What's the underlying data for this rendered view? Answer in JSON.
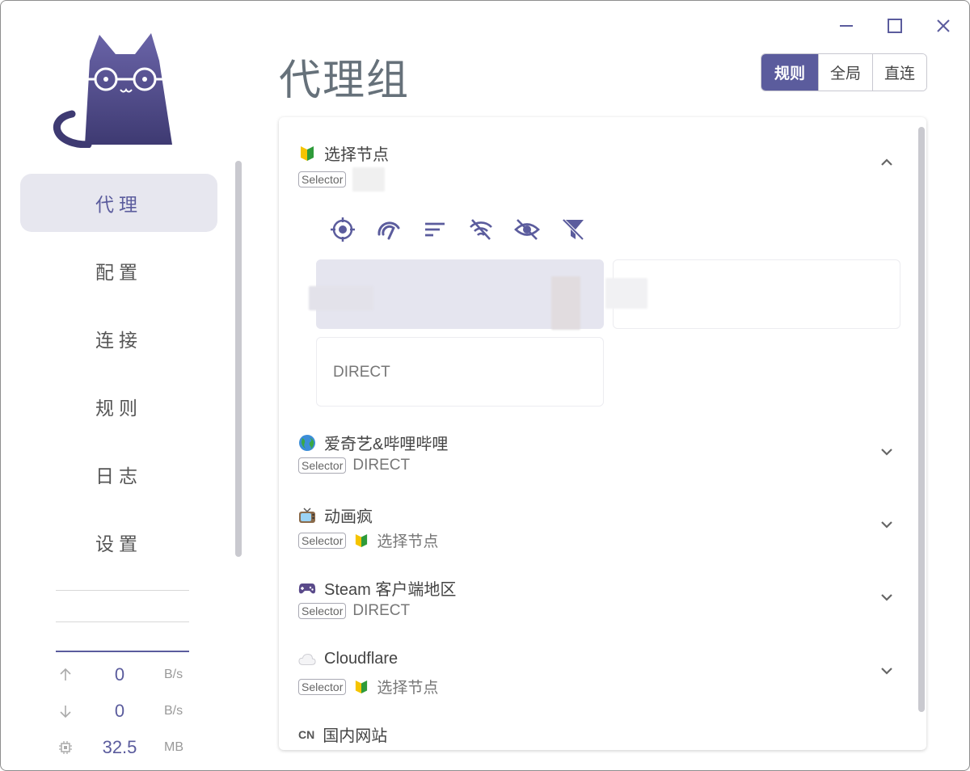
{
  "window": {
    "controls": [
      "minimize",
      "maximize",
      "close"
    ]
  },
  "sidebar": {
    "nav": [
      {
        "label": "代理",
        "active": true
      },
      {
        "label": "配置",
        "active": false
      },
      {
        "label": "连接",
        "active": false
      },
      {
        "label": "规则",
        "active": false
      },
      {
        "label": "日志",
        "active": false
      },
      {
        "label": "设置",
        "active": false
      }
    ],
    "stats": {
      "upload": {
        "value": "0",
        "unit": "B/s"
      },
      "download": {
        "value": "0",
        "unit": "B/s"
      },
      "memory": {
        "value": "32.5",
        "unit": "MB"
      }
    }
  },
  "main": {
    "title": "代理组",
    "modes": [
      {
        "label": "规则",
        "active": true
      },
      {
        "label": "全局",
        "active": false
      },
      {
        "label": "直连",
        "active": false
      }
    ]
  },
  "groups": [
    {
      "name": "选择节点",
      "icon": "beginner-badge-icon",
      "type": "Selector",
      "now": "",
      "now_icon": "",
      "expanded": true,
      "proxies": [
        {
          "name": "",
          "selected": true
        },
        {
          "name": "",
          "selected": false
        },
        {
          "name": "DIRECT",
          "selected": false
        }
      ]
    },
    {
      "name": "爱奇艺&哔哩哔哩",
      "icon": "globe-icon",
      "type": "Selector",
      "now": "DIRECT",
      "now_icon": "",
      "expanded": false
    },
    {
      "name": "动画疯",
      "icon": "television-icon",
      "type": "Selector",
      "now": "选择节点",
      "now_icon": "beginner-badge-icon",
      "expanded": false
    },
    {
      "name": "Steam 客户端地区",
      "icon": "game-controller-icon",
      "type": "Selector",
      "now": "DIRECT",
      "now_icon": "",
      "expanded": false
    },
    {
      "name": "Cloudflare",
      "icon": "cloud-icon",
      "type": "Selector",
      "now": "选择节点",
      "now_icon": "beginner-badge-icon",
      "expanded": false
    },
    {
      "name": "国内网站",
      "icon": "cn-flag-icon",
      "icon_text": "CN",
      "expanded": false
    }
  ],
  "toolbar_icons": [
    "locate-icon",
    "speed-test-icon",
    "sort-icon",
    "wifi-off-icon",
    "eye-off-icon",
    "filter-off-icon"
  ],
  "colors": {
    "accent": "#5b5c9d",
    "nav_active_bg": "#e7e7ef",
    "selected_card_bg": "#e5e5ef",
    "title_text": "#66717a"
  }
}
